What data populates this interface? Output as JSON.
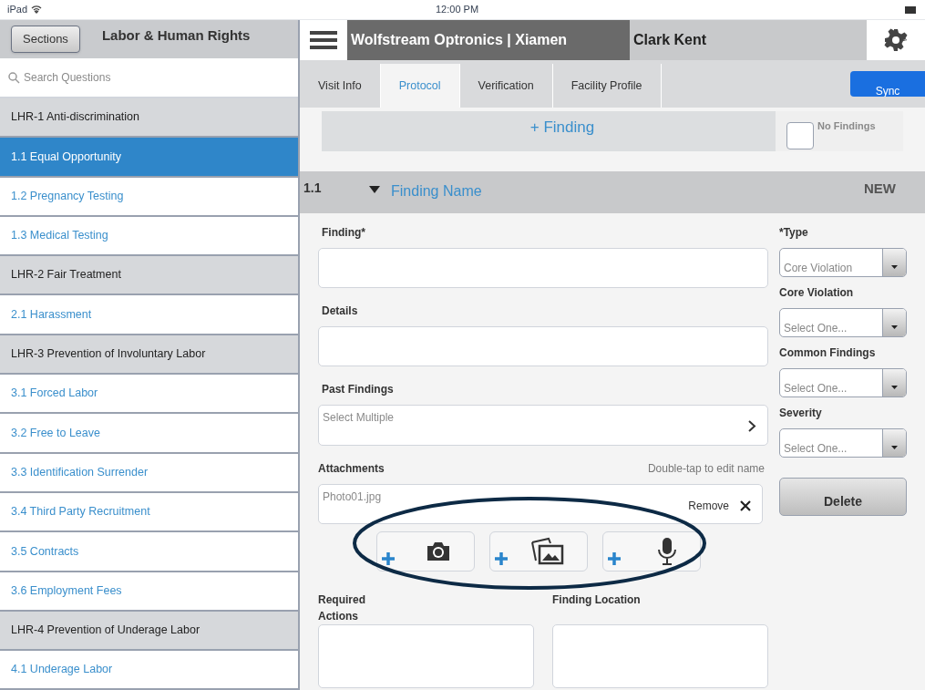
{
  "status_bar": {
    "device": "iPad",
    "time": "12:00 PM"
  },
  "sidebar": {
    "sections_button": "Sections",
    "title": "Labor & Human Rights",
    "search_placeholder": "Search Questions",
    "items": [
      {
        "kind": "section",
        "label": "LHR-1 Anti-discrimination",
        "selected": false
      },
      {
        "kind": "question",
        "label": "1.1 Equal Opportunity",
        "selected": true
      },
      {
        "kind": "question",
        "label": "1.2 Pregnancy Testing",
        "selected": false
      },
      {
        "kind": "question",
        "label": "1.3 Medical Testing",
        "selected": false
      },
      {
        "kind": "section",
        "label": "LHR-2 Fair Treatment",
        "selected": false
      },
      {
        "kind": "question",
        "label": "2.1 Harassment",
        "selected": false
      },
      {
        "kind": "section",
        "label": "LHR-3 Prevention of Involuntary Labor",
        "selected": false
      },
      {
        "kind": "question",
        "label": "3.1 Forced Labor",
        "selected": false
      },
      {
        "kind": "question",
        "label": "3.2 Free to Leave",
        "selected": false
      },
      {
        "kind": "question",
        "label": "3.3 Identification Surrender",
        "selected": false
      },
      {
        "kind": "question",
        "label": "3.4 Third Party Recruitment",
        "selected": false
      },
      {
        "kind": "question",
        "label": "3.5 Contracts",
        "selected": false
      },
      {
        "kind": "question",
        "label": "3.6 Employment Fees",
        "selected": false
      },
      {
        "kind": "section",
        "label": "LHR-4 Prevention of Underage Labor",
        "selected": false
      },
      {
        "kind": "question",
        "label": "4.1 Underage Labor",
        "selected": false
      }
    ]
  },
  "header": {
    "company": "Wolfstream Optronics | Xiamen",
    "user": "Clark Kent"
  },
  "tabs": [
    {
      "label": "Visit Info",
      "selected": false
    },
    {
      "label": "Protocol",
      "selected": true
    },
    {
      "label": "Verification",
      "selected": false
    },
    {
      "label": "Facility Profile",
      "selected": false
    }
  ],
  "sync_button": "Sync",
  "finding_bar": {
    "add_label": "+ Finding",
    "no_findings_label": "No Findings",
    "no_findings_checked": false
  },
  "finding": {
    "number": "1.1",
    "name": "Finding Name",
    "expanded": true,
    "status": "NEW"
  },
  "form": {
    "finding_label": "Finding*",
    "details_label": "Details",
    "past_findings_label": "Past Findings",
    "past_findings_placeholder": "Select Multiple",
    "attachments_label": "Attachments",
    "attachments_hint": "Double-tap to edit name",
    "files": [
      {
        "name": "Photo01.jpg",
        "remove_label": "Remove"
      }
    ],
    "add_buttons": [
      {
        "kind": "camera"
      },
      {
        "kind": "gallery"
      },
      {
        "kind": "microphone"
      }
    ],
    "required_actions_label": "Required Actions",
    "finding_location_label": "Finding Location"
  },
  "dropdowns": [
    {
      "label": "*Type",
      "value": "Core Violation"
    },
    {
      "label": "Core Violation",
      "value": "Select One..."
    },
    {
      "label": "Common Findings",
      "value": "Select One..."
    },
    {
      "label": "Severity",
      "value": "Select One..."
    }
  ],
  "delete_button": "Delete"
}
